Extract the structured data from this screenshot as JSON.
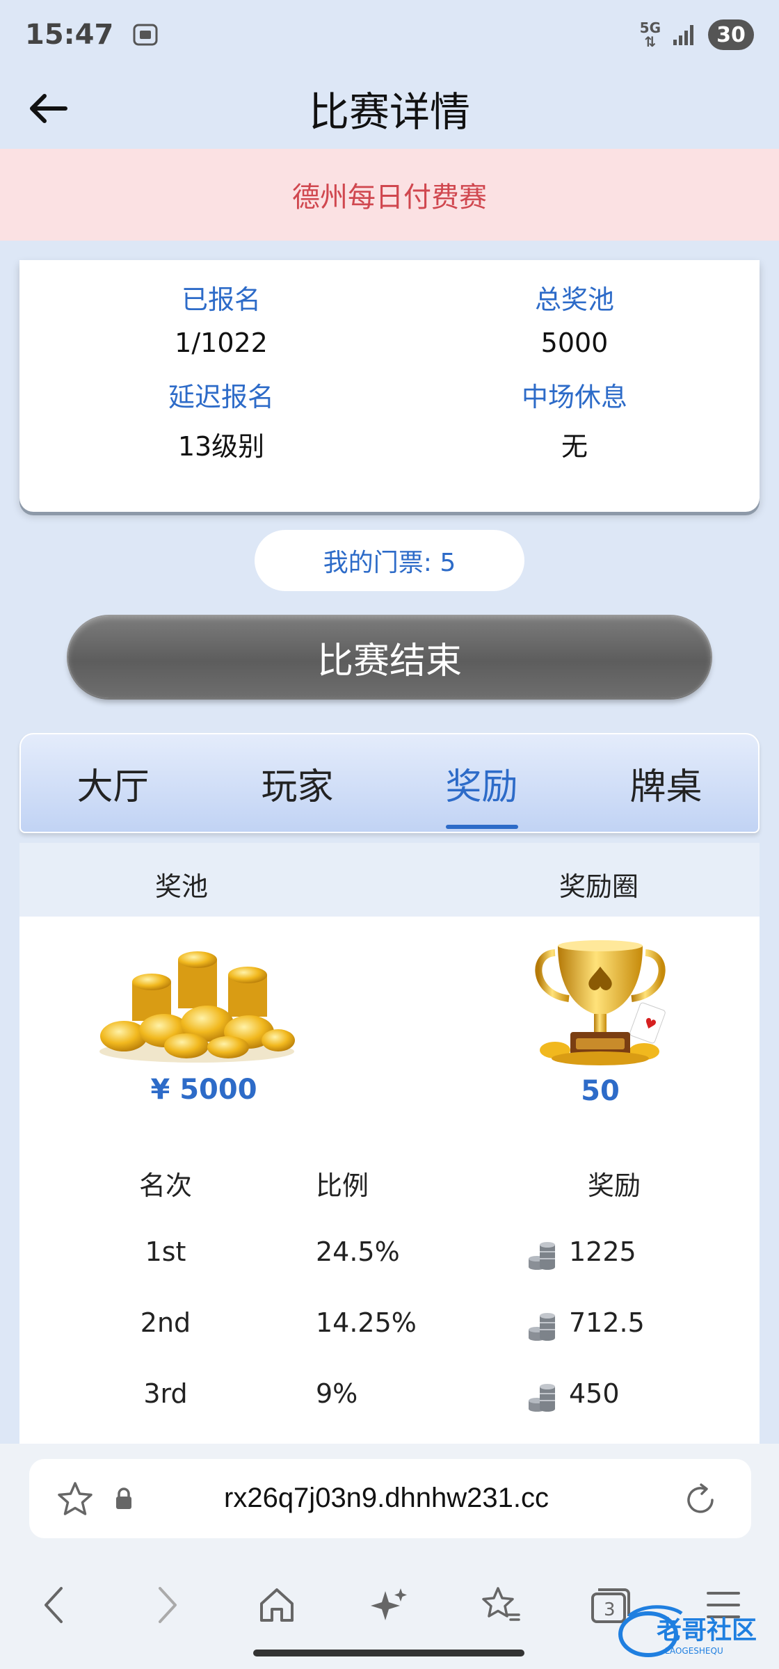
{
  "status_bar": {
    "time": "15:47",
    "network": "5G",
    "battery": "30"
  },
  "header": {
    "title": "比赛详情"
  },
  "event": {
    "name": "德州每日付费赛"
  },
  "info": {
    "registered_label": "已报名",
    "registered_value": "1/1022",
    "prize_pool_label": "总奖池",
    "prize_pool_value": "5000",
    "late_reg_label": "延迟报名",
    "late_reg_value": "13级别",
    "break_label": "中场休息",
    "break_value": "无"
  },
  "ticket": {
    "text": "我的门票: 5"
  },
  "action_button": {
    "label": "比赛结束"
  },
  "tabs": [
    {
      "label": "大厅",
      "active": false
    },
    {
      "label": "玩家",
      "active": false
    },
    {
      "label": "奖励",
      "active": true
    },
    {
      "label": "牌桌",
      "active": false
    }
  ],
  "rewards": {
    "pool_header": "奖池",
    "circle_header": "奖励圈",
    "pool_amount": "¥ 5000",
    "circle_value": "50",
    "columns": [
      "名次",
      "比例",
      "奖励"
    ],
    "rows": [
      {
        "rank": "1st",
        "ratio": "24.5%",
        "amount": "1225"
      },
      {
        "rank": "2nd",
        "ratio": "14.25%",
        "amount": "712.5"
      },
      {
        "rank": "3rd",
        "ratio": "9%",
        "amount": "450"
      }
    ]
  },
  "browser": {
    "url": "rx26q7j03n9.dhnhw231.cc",
    "tab_count": "3"
  },
  "watermark": {
    "text": "老哥社区",
    "sub": "LAOGESHEQU"
  },
  "colors": {
    "accent": "#2d6bc8",
    "banner_bg": "#fbe1e3",
    "banner_text": "#d0474f",
    "page_bg": "#dde7f6"
  }
}
